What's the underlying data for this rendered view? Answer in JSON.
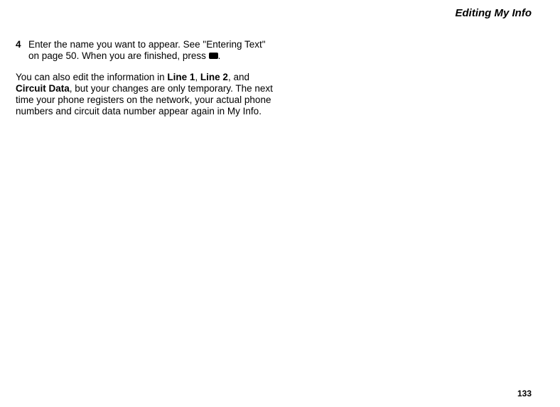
{
  "header": {
    "title": "Editing My Info"
  },
  "step": {
    "number": "4",
    "text_before_ref": "Enter the name you want to appear. See \"Entering Text\" on page 50. When you are finished, press ",
    "text_after_ref": "."
  },
  "para": {
    "prefix": "You can also edit the information in ",
    "line1": "Line 1",
    "sep1": ", ",
    "line2": "Line 2",
    "sep2": ", and ",
    "circuit": "Circuit Data",
    "suffix": ", but your changes are only temporary. The next time your phone registers on the network, your actual phone numbers and circuit data number appear again in My Info."
  },
  "footer": {
    "page_number": "133"
  }
}
